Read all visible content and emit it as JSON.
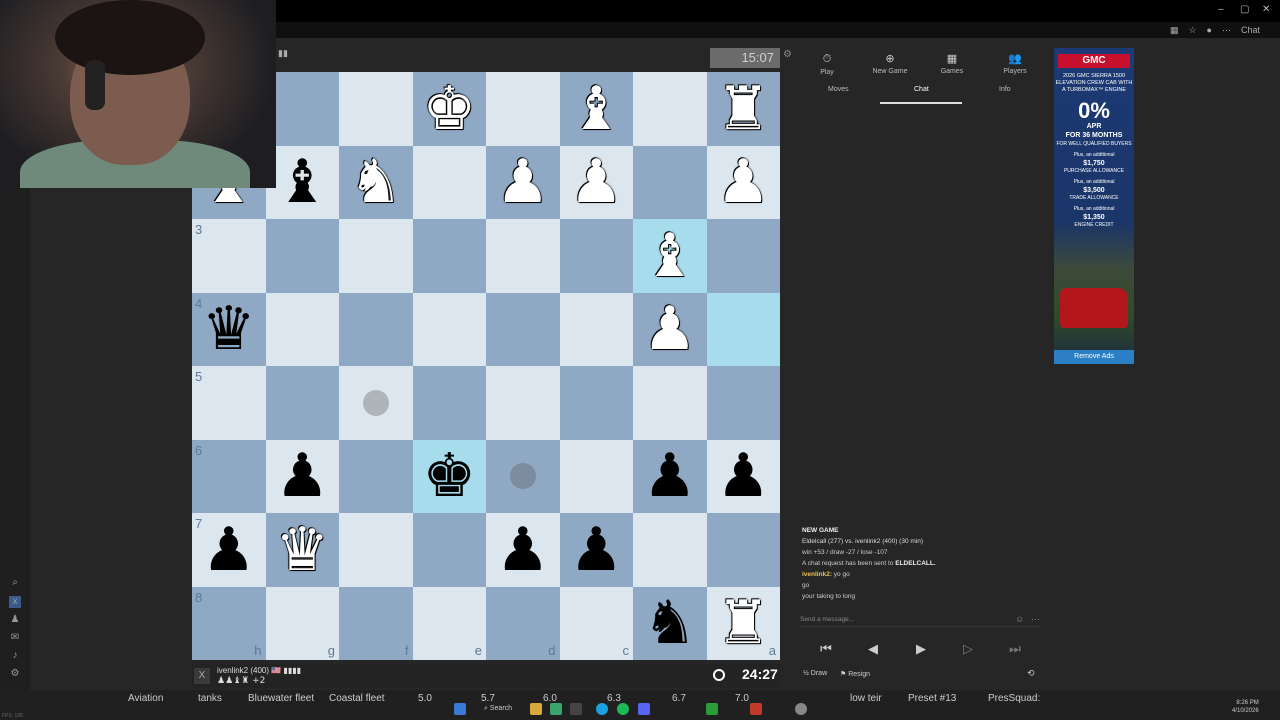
{
  "browser": {
    "window_controls": [
      "–",
      "▢",
      "✕"
    ],
    "chat_button": "Chat"
  },
  "game": {
    "timer_top": "15:07",
    "timer_bottom": "24:27",
    "rank_labels": [
      "3",
      "4",
      "5",
      "6",
      "7",
      "8"
    ],
    "file_labels": [
      "h",
      "g",
      "f",
      "e",
      "d",
      "c",
      "a"
    ],
    "player_name": "ivenlink2 (400) 🇺🇸 ▮▮▮▮",
    "player_captures": "♟♟♝♜ +2",
    "pieces": [
      {
        "sq": "h1",
        "glyph": "♚",
        "color": "white"
      },
      {
        "sq": "e1",
        "glyph": "♚",
        "color": "white"
      },
      {
        "sq": "c1",
        "glyph": "♝",
        "color": "white"
      },
      {
        "sq": "a1",
        "glyph": "♜",
        "color": "white"
      },
      {
        "sq": "h2",
        "glyph": "♝",
        "color": "white"
      },
      {
        "sq": "g2",
        "glyph": "♝",
        "color": "black"
      },
      {
        "sq": "f2",
        "glyph": "♞",
        "color": "white"
      },
      {
        "sq": "d2",
        "glyph": "♟",
        "color": "white"
      },
      {
        "sq": "c2",
        "glyph": "♟",
        "color": "white"
      },
      {
        "sq": "a2",
        "glyph": "♟",
        "color": "white"
      },
      {
        "sq": "b3",
        "glyph": "♝",
        "color": "white"
      },
      {
        "sq": "h4",
        "glyph": "♛",
        "color": "black"
      },
      {
        "sq": "b4",
        "glyph": "♟",
        "color": "white"
      },
      {
        "sq": "g6",
        "glyph": "♟",
        "color": "black"
      },
      {
        "sq": "e6",
        "glyph": "♚",
        "color": "black"
      },
      {
        "sq": "b6",
        "glyph": "♟",
        "color": "black"
      },
      {
        "sq": "a6",
        "glyph": "♟",
        "color": "black"
      },
      {
        "sq": "h7",
        "glyph": "♟",
        "color": "black"
      },
      {
        "sq": "g7",
        "glyph": "♛",
        "color": "white"
      },
      {
        "sq": "d7",
        "glyph": "♟",
        "color": "black"
      },
      {
        "sq": "c7",
        "glyph": "♟",
        "color": "black"
      },
      {
        "sq": "b8",
        "glyph": "♞",
        "color": "black"
      },
      {
        "sq": "a8",
        "glyph": "♜",
        "color": "white"
      }
    ],
    "highlighted_squares": [
      "b3",
      "a4",
      "e6"
    ],
    "move_dots": [
      "f5",
      "d6"
    ]
  },
  "panel": {
    "nav": [
      {
        "label": "Play",
        "icon": "⏱"
      },
      {
        "label": "New Game",
        "icon": "⊕"
      },
      {
        "label": "Games",
        "icon": "▦"
      },
      {
        "label": "Players",
        "icon": "👥"
      }
    ],
    "subtabs": [
      "Moves",
      "Chat",
      "Info"
    ],
    "active_subtab": "Chat",
    "chat": {
      "header": "NEW GAME",
      "match": "Eldelcall (277) vs. ivenlink2 (400) (30 min)",
      "stats": "win +53 / draw -27 / lose -107",
      "request_prefix": "A chat request has been sent to ",
      "request_user": "ELDELCALL.",
      "msg1_user": "ivenlink2:",
      "msg1_text": " yo go",
      "msg2": "go",
      "msg3": "your taking to long"
    },
    "input_placeholder": "Send a message...",
    "controls": [
      "⏮",
      "◀",
      "▶",
      "▷",
      "⏭"
    ],
    "draw_label": "Draw",
    "resign_label": "Resign"
  },
  "ad": {
    "brand": "GMC",
    "line1": "2026 GMC SIERRA 1500 ELEVATION CREW CAB WITH A TURBOMAX™ ENGINE",
    "big": "0%",
    "apr": "APR",
    "months": "FOR 36 MONTHS",
    "fine": "FOR WELL QUALIFIED BUYERS",
    "plus1": "Plus, an additional",
    "amount1": "$1,750",
    "label1": "PURCHASE ALLOWANCE",
    "plus2": "Plus, an additional",
    "amount2": "$3,500",
    "label2": "TRADE ALLOWANCE",
    "plus3": "Plus, an additional",
    "amount3": "$1,350",
    "label3": "ENGINE CREDIT",
    "remove": "Remove Ads"
  },
  "taskbar": {
    "overlay_items": [
      "Aviation",
      "tanks",
      "Bluewater fleet",
      "Coastal fleet",
      "5.0",
      "5.7",
      "6.0",
      "6.3",
      "6.7",
      "7.0",
      "low teir",
      "Preset #13",
      "PresSquad:"
    ],
    "search": "Search",
    "time": "8:26 PM",
    "date": "4/10/2026",
    "fps": "FPS: 195"
  }
}
